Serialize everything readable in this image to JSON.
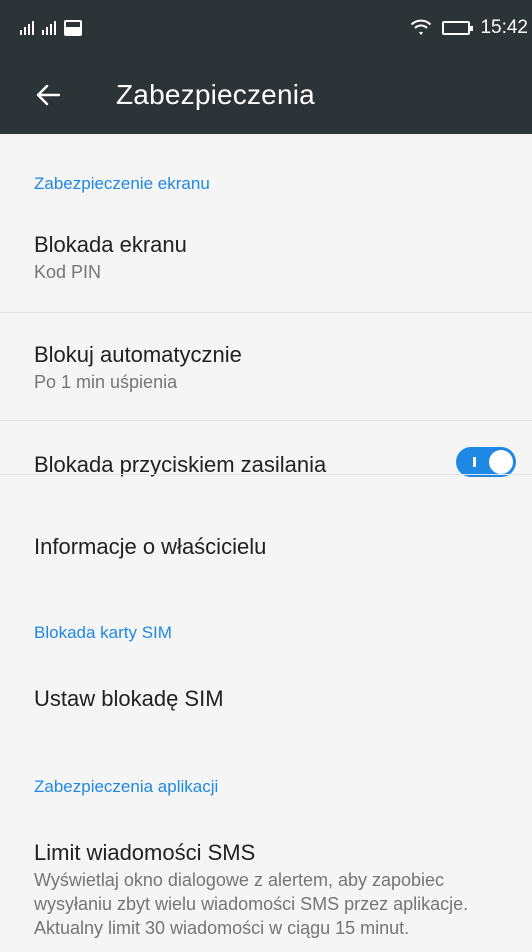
{
  "status": {
    "time": "15:42"
  },
  "app_bar": {
    "title": "Zabezpieczenia"
  },
  "sections": {
    "screen": "Zabezpieczenie ekranu",
    "sim": "Blokada karty SIM",
    "apps": "Zabezpieczenia aplikacji"
  },
  "items": {
    "screen_lock": {
      "title": "Blokada ekranu",
      "summary": "Kod PIN"
    },
    "auto_lock": {
      "title": "Blokuj automatycznie",
      "summary": "Po 1 min uśpienia"
    },
    "power_lock": {
      "title": "Blokada przyciskiem zasilania",
      "enabled": true
    },
    "owner_info": {
      "title": "Informacje o właścicielu"
    },
    "sim_lock": {
      "title": "Ustaw blokadę SIM"
    },
    "sms_limit": {
      "title": "Limit wiadomości SMS",
      "summary": "Wyświetlaj okno dialogowe z alertem, aby zapobiec wysyłaniu zbyt wielu wiadomości SMS przez aplikacje. Aktualny limit 30 wiadomości w ciągu 15 minut."
    }
  },
  "colors": {
    "bar": "#2d3437",
    "accent": "#1e88e5"
  }
}
